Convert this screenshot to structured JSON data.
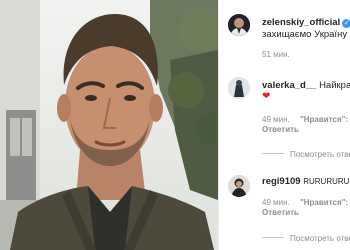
{
  "post": {
    "author": "zelenskiy_official",
    "verified_badge": "✓",
    "caption_start": "M",
    "caption_line2": "захищаємо Україну",
    "time": "51 мин."
  },
  "comments": [
    {
      "username": "valerka_d__",
      "text": "Найкращ",
      "emoji": "❤",
      "time": "49 мин.",
      "likes": "\"Нравится\": 9",
      "reply": "Ответить",
      "view_replies": "Посмотреть отве"
    },
    {
      "username": "regi9109",
      "text": "RURURURURURU",
      "time": "49 мин.",
      "likes": "\"Нравится\": 3",
      "reply": "Ответить",
      "view_replies": "Посмотреть отве"
    }
  ],
  "icons": {
    "like": "heart-outline-icon",
    "verified": "verified-badge-icon"
  },
  "colors": {
    "verified": "#3897f0",
    "heart": "#ed1c24",
    "muted": "#8e8e8e",
    "text": "#262626"
  }
}
